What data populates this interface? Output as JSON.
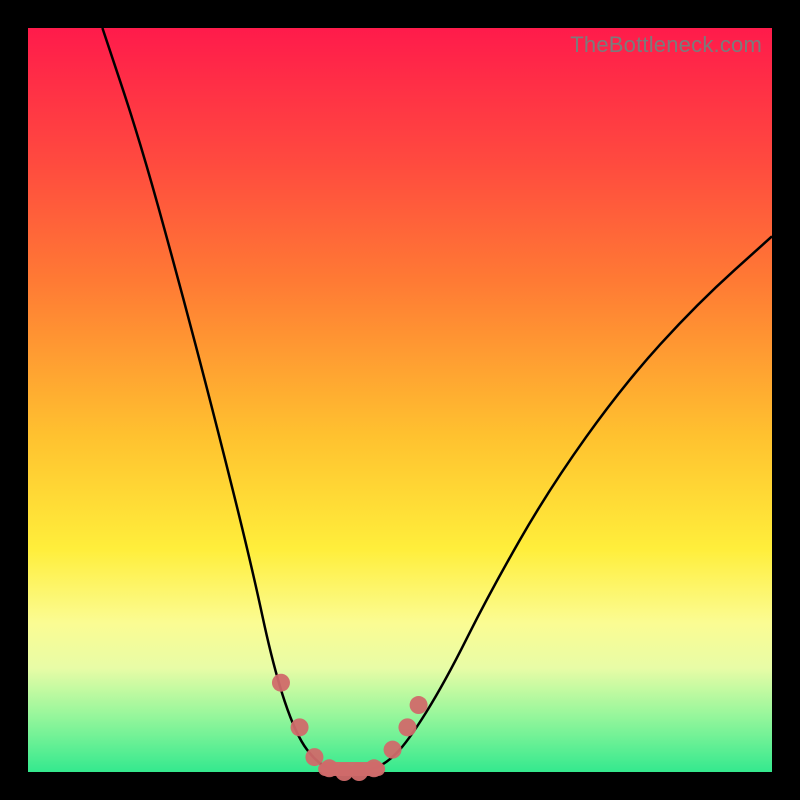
{
  "watermark": "TheBottleneck.com",
  "colors": {
    "frame_bg": "#000000",
    "gradient_top": "#ff1b4b",
    "gradient_bottom": "#34e98e",
    "curve": "#000000",
    "marker": "#d06a6a"
  },
  "chart_data": {
    "type": "line",
    "title": "",
    "xlabel": "",
    "ylabel": "",
    "xlim": [
      0,
      100
    ],
    "ylim": [
      0,
      100
    ],
    "grid": false,
    "legend": false,
    "curve": [
      {
        "x": 10,
        "y": 100
      },
      {
        "x": 15,
        "y": 85
      },
      {
        "x": 20,
        "y": 67
      },
      {
        "x": 25,
        "y": 48
      },
      {
        "x": 30,
        "y": 28
      },
      {
        "x": 33,
        "y": 14
      },
      {
        "x": 36,
        "y": 5
      },
      {
        "x": 39,
        "y": 1
      },
      {
        "x": 42,
        "y": 0
      },
      {
        "x": 45,
        "y": 0
      },
      {
        "x": 48,
        "y": 1
      },
      {
        "x": 51,
        "y": 4
      },
      {
        "x": 56,
        "y": 12
      },
      {
        "x": 62,
        "y": 24
      },
      {
        "x": 70,
        "y": 38
      },
      {
        "x": 80,
        "y": 52
      },
      {
        "x": 90,
        "y": 63
      },
      {
        "x": 100,
        "y": 72
      }
    ],
    "markers": [
      {
        "x": 34,
        "y": 12
      },
      {
        "x": 36.5,
        "y": 6
      },
      {
        "x": 38.5,
        "y": 2
      },
      {
        "x": 40.5,
        "y": 0.5
      },
      {
        "x": 42.5,
        "y": 0
      },
      {
        "x": 44.5,
        "y": 0
      },
      {
        "x": 46.5,
        "y": 0.5
      },
      {
        "x": 49,
        "y": 3
      },
      {
        "x": 51,
        "y": 6
      },
      {
        "x": 52.5,
        "y": 9
      }
    ],
    "trough_range": {
      "x_start": 39,
      "x_end": 48,
      "y": 0
    }
  }
}
